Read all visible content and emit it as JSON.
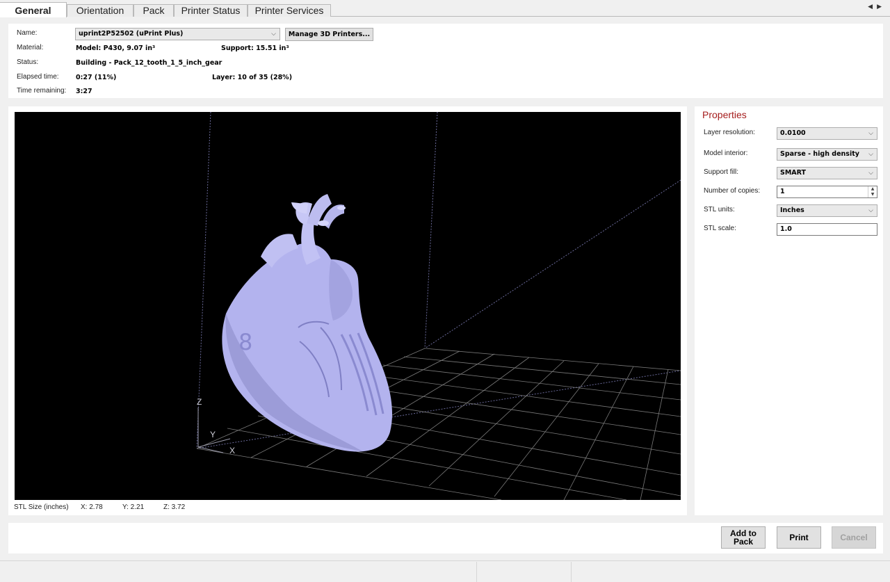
{
  "tabs": [
    {
      "label": "General",
      "active": true
    },
    {
      "label": "Orientation",
      "active": false
    },
    {
      "label": "Pack",
      "active": false
    },
    {
      "label": "Printer Status",
      "active": false
    },
    {
      "label": "Printer Services",
      "active": false
    }
  ],
  "info": {
    "name_label": "Name:",
    "name_value": "uprint2P52502  (uPrint Plus)",
    "manage_button": "Manage 3D Printers...",
    "material_label": "Material:",
    "material_value": "Model: P430, 9.07 in³",
    "support_value": "Support: 15.51 in³",
    "status_label": "Status:",
    "status_value": "Building  -  Pack_12_tooth_1_5_inch_gear",
    "elapsed_label": "Elapsed time:",
    "elapsed_value": "0:27  (11%)",
    "layer_value": "Layer: 10 of 35  (28%)",
    "remaining_label": "Time remaining:",
    "remaining_value": "3:27"
  },
  "viewport": {
    "axis_z": "Z",
    "axis_y": "Y",
    "axis_x": "X",
    "model_color": "#b3b3ee",
    "background": "#000000"
  },
  "stl_size": {
    "label": "STL Size (inches)",
    "x": "X:  2.78",
    "y": "Y:  2.21",
    "z": "Z:  3.72"
  },
  "properties": {
    "title": "Properties",
    "layer_resolution_label": "Layer resolution:",
    "layer_resolution_value": "0.0100",
    "model_interior_label": "Model interior:",
    "model_interior_value": "Sparse - high density",
    "support_fill_label": "Support fill:",
    "support_fill_value": "SMART",
    "copies_label": "Number of copies:",
    "copies_value": "1",
    "stl_units_label": "STL units:",
    "stl_units_value": "Inches",
    "stl_scale_label": "STL scale:",
    "stl_scale_value": "1.0"
  },
  "actions": {
    "add_to_pack": "Add to Pack",
    "print": "Print",
    "cancel": "Cancel"
  }
}
